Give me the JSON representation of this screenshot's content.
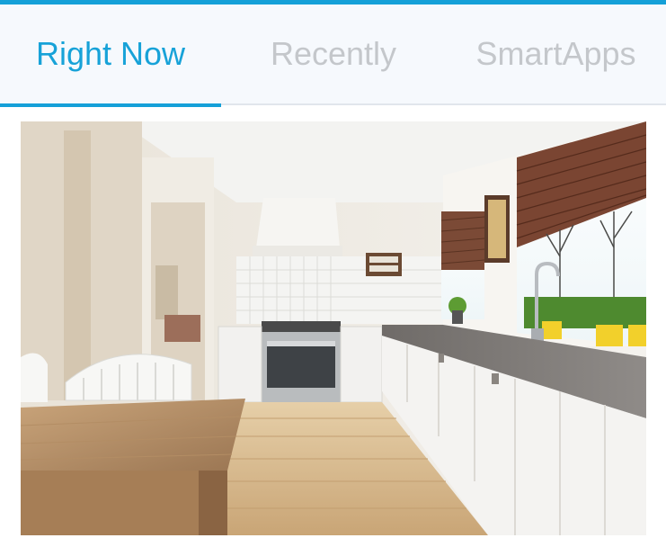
{
  "tabs": [
    {
      "label": "Right Now",
      "active": true
    },
    {
      "label": "Recently",
      "active": false
    },
    {
      "label": "SmartApps",
      "active": false
    }
  ],
  "colors": {
    "accent": "#15a0d8",
    "tab_inactive": "#c4c7cb",
    "tab_bar_bg": "#f6f9fd"
  },
  "main": {
    "image": {
      "subject": "kitchen-photo"
    }
  }
}
